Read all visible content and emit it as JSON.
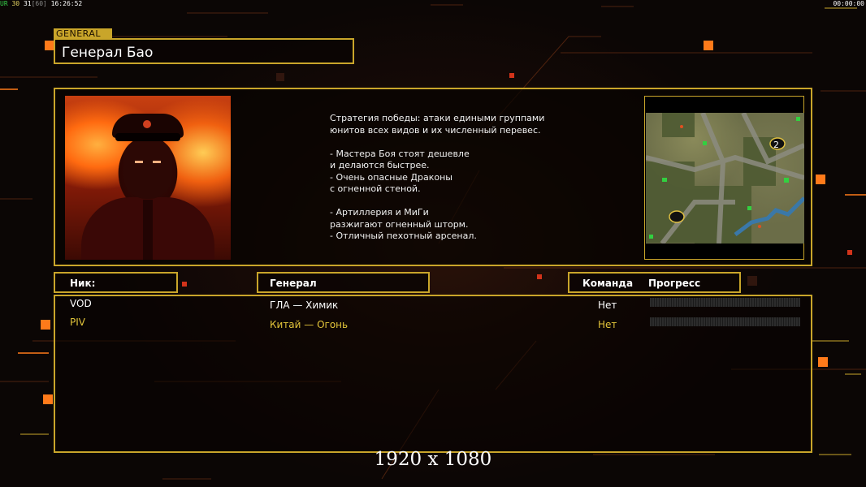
{
  "top_bar": {
    "stats_label": "UR",
    "stats_a": "30",
    "stats_b": "31",
    "stats_c": "[60]",
    "time": "16:26:52",
    "clock": "00:00:00"
  },
  "general": {
    "tag": "GENERAL",
    "name": "Генерал Бао",
    "description": "Стратегия победы: атаки едиными группами\nюнитов всех видов и их численный перевес.\n\n- Мастера Боя стоят дешевле\nи делаются быстрее.\n- Очень опасные Драконы\nс огненной стеной.\n\n- Артиллерия и МиГи\nразжигают огненный шторм.\n- Отличный пехотный арсенал."
  },
  "map": {
    "start_marker": "2"
  },
  "columns": {
    "nick": "Ник:",
    "general": "Генерал",
    "team": "Команда",
    "progress": "Прогресс"
  },
  "players": [
    {
      "nick": "VOD",
      "general": "ГЛА — Химик",
      "team": "Нет",
      "progress": 0,
      "color": "#ffffff"
    },
    {
      "nick": "PIV",
      "general": "Китай — Огонь",
      "team": "Нет",
      "progress": 0,
      "color": "#e2c43a"
    }
  ],
  "overlay": {
    "resolution": "1920 x 1080"
  },
  "colors": {
    "accent_gold": "#c9a52a",
    "deco_orange": "#ff7a1a",
    "deco_red": "#e0321a"
  }
}
